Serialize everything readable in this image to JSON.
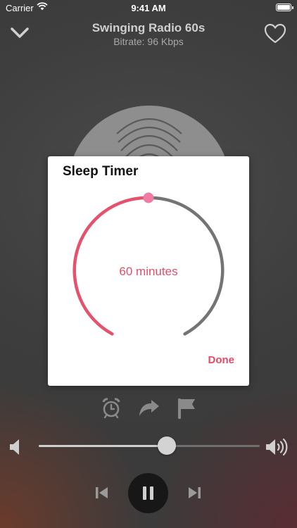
{
  "status_bar": {
    "carrier": "Carrier",
    "time": "9:41 AM"
  },
  "header": {
    "title": "Swinging Radio 60s",
    "subtitle": "Bitrate: 96 Kbps"
  },
  "sleep_timer": {
    "title": "Sleep Timer",
    "value_label": "60 minutes",
    "progress_fraction": 0.5,
    "done_label": "Done"
  },
  "volume": {
    "level": 0.58
  },
  "colors": {
    "accent": "#e5526b",
    "track": "#747474",
    "thumb": "#f07ca4"
  },
  "icons": {
    "header_left": "chevron-down-icon",
    "header_right": "heart-icon",
    "actions": [
      "alarm-clock-icon",
      "share-arrow-icon",
      "flag-icon"
    ],
    "volume_low": "speaker-low-icon",
    "volume_high": "speaker-high-icon",
    "transport": [
      "previous-track-icon",
      "pause-icon",
      "next-track-icon"
    ]
  }
}
